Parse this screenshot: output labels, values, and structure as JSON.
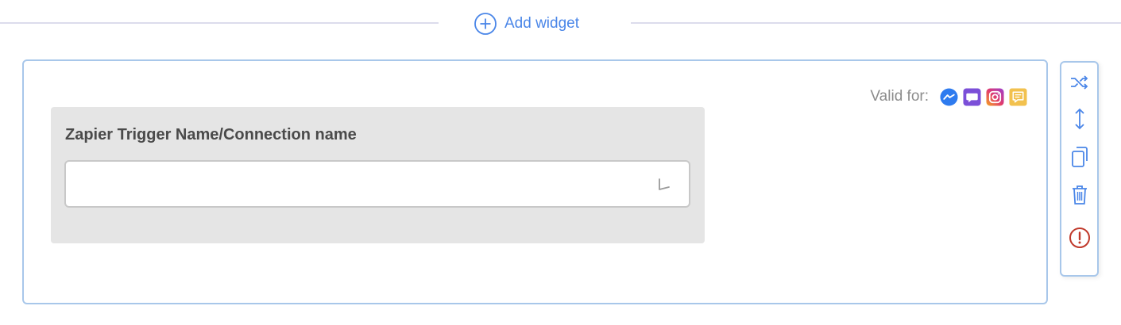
{
  "divider": {
    "add_widget_label": "Add widget",
    "add_icon": "plus-circle-icon"
  },
  "widget": {
    "valid_for_label": "Valid for:",
    "channels": [
      {
        "name": "messenger",
        "icon": "messenger-icon",
        "color": "#2e7bef"
      },
      {
        "name": "chat",
        "icon": "chat-bubble-icon",
        "color": "#7b4fd8"
      },
      {
        "name": "instagram",
        "icon": "instagram-icon",
        "color": "#e03a6e"
      },
      {
        "name": "sms",
        "icon": "message-icon",
        "color": "#f2c14e"
      }
    ],
    "trigger_field": {
      "label": "Zapier Trigger Name/Connection name",
      "value": "",
      "icon": "chevron-down-icon"
    }
  },
  "toolbar": {
    "actions": [
      {
        "name": "shuffle",
        "icon": "shuffle-icon"
      },
      {
        "name": "move",
        "icon": "vertical-resize-icon"
      },
      {
        "name": "duplicate",
        "icon": "copy-icon"
      },
      {
        "name": "delete",
        "icon": "trash-icon"
      },
      {
        "name": "error",
        "icon": "alert-circle-icon",
        "color": "#c0392b"
      }
    ]
  },
  "colors": {
    "accent": "#4a86e8",
    "card_border": "#a8c7ea",
    "panel_bg": "#e5e5e5",
    "error": "#c0392b"
  }
}
